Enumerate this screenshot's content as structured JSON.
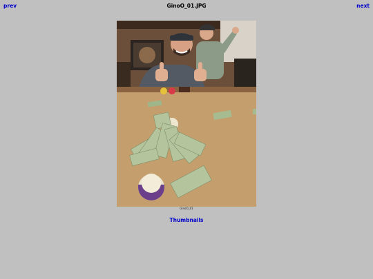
{
  "nav": {
    "prev_label": "prev",
    "next_label": "next"
  },
  "header": {
    "title": "GinoO_01.JPG"
  },
  "photo": {
    "caption": "GinoO_01"
  },
  "footer": {
    "thumbnails_label": "Thumbnails"
  },
  "colors": {
    "background": "#c0c0c0",
    "link": "#0000cc",
    "felt": "#c09a68"
  }
}
